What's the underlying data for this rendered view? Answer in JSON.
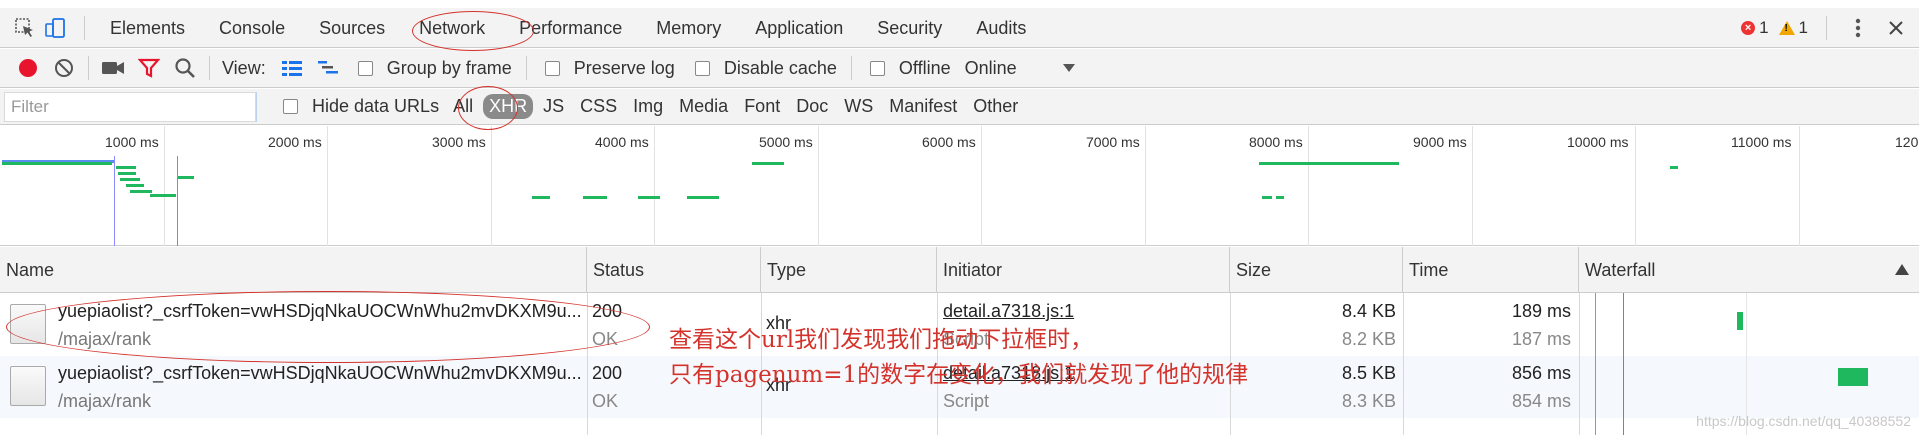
{
  "tabs": [
    "Elements",
    "Console",
    "Sources",
    "Network",
    "Performance",
    "Memory",
    "Application",
    "Security",
    "Audits"
  ],
  "issues": {
    "errors": "1",
    "warnings": "1"
  },
  "toolbar": {
    "view_label": "View:",
    "group_by_frame": "Group by frame",
    "preserve_log": "Preserve log",
    "disable_cache": "Disable cache",
    "offline": "Offline",
    "throttle_value": "Online"
  },
  "filter": {
    "placeholder": "Filter",
    "hide_data_urls": "Hide data URLs",
    "types": [
      "All",
      "XHR",
      "JS",
      "CSS",
      "Img",
      "Media",
      "Font",
      "Doc",
      "WS",
      "Manifest",
      "Other"
    ],
    "active_type": "XHR"
  },
  "overview": {
    "ticks": [
      "1000 ms",
      "2000 ms",
      "3000 ms",
      "4000 ms",
      "5000 ms",
      "6000 ms",
      "7000 ms",
      "8000 ms",
      "9000 ms",
      "10000 ms",
      "11000 ms",
      "120"
    ]
  },
  "table": {
    "columns": [
      "Name",
      "Status",
      "Type",
      "Initiator",
      "Size",
      "Time",
      "Waterfall"
    ],
    "rows": [
      {
        "name": "yuepiaolist?_csrfToken=vwHSDjqNkaUOCWnWhu2mvDKXM9u...",
        "path": "/majax/rank",
        "status": "200",
        "status_text": "OK",
        "type": "xhr",
        "initiator": "detail.a7318.js:1",
        "initiator_sub": "Script",
        "size": "8.4 KB",
        "size_sub": "8.2 KB",
        "time": "189 ms",
        "time_sub": "187 ms"
      },
      {
        "name": "yuepiaolist?_csrfToken=vwHSDjqNkaUOCWnWhu2mvDKXM9u...",
        "path": "/majax/rank",
        "status": "200",
        "status_text": "OK",
        "type": "xhr",
        "initiator": "detail.a7318.js:1",
        "initiator_sub": "Script",
        "size": "8.5 KB",
        "size_sub": "8.3 KB",
        "time": "856 ms",
        "time_sub": "854 ms"
      }
    ]
  },
  "annotation": {
    "line1": "查看这个url我们发现我们拖动下拉框时，",
    "line2": "只有pagenum=1的数字在变化，我们就发现了他的规律",
    "color": "#d4332c"
  },
  "watermark": "https://blog.csdn.net/qq_40388552"
}
